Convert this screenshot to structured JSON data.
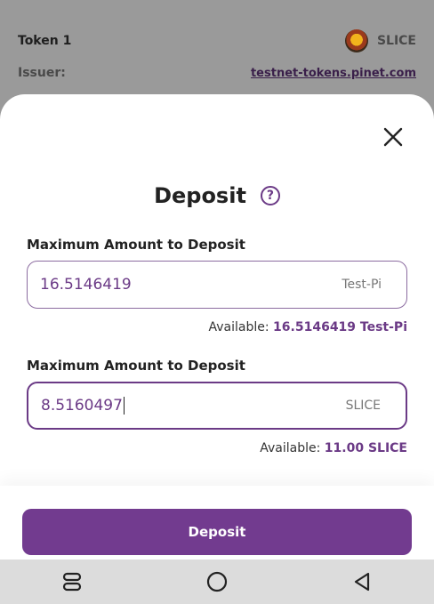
{
  "background": {
    "token_label": "Token 1",
    "asset_code": "SLICE",
    "issuer_label": "Issuer:",
    "issuer_value": "testnet-tokens.pinet.com"
  },
  "modal": {
    "title": "Deposit",
    "help_symbol": "?",
    "fields": [
      {
        "label": "Maximum Amount to Deposit",
        "value": "16.5146419",
        "unit": "Test-Pi",
        "available_label": "Available:",
        "available_value": "16.5146419 Test-Pi"
      },
      {
        "label": "Maximum Amount to Deposit",
        "value": "8.5160497",
        "unit": "SLICE",
        "available_label": "Available:",
        "available_value": "11.00 SLICE"
      }
    ],
    "submit_label": "Deposit"
  },
  "icons": {
    "close": "close-icon",
    "help": "help-icon",
    "asset": "slice-token-icon",
    "nav_recents": "recents-icon",
    "nav_home": "home-icon",
    "nav_back": "back-icon"
  },
  "colors": {
    "accent": "#723b8f",
    "accent_text": "#6b3a86",
    "overlay": "#7c7c7c",
    "navbar": "#dcdcdc"
  }
}
